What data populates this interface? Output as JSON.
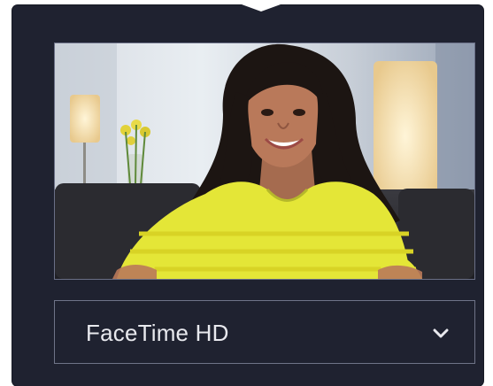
{
  "camera_picker": {
    "selected_camera": "FaceTime HD",
    "dropdown_icon": "chevron-down-icon",
    "preview_icon": "camera-preview",
    "colors": {
      "panel": "#1f2230",
      "border": "#6f7488",
      "text": "#e8e9ee"
    }
  }
}
